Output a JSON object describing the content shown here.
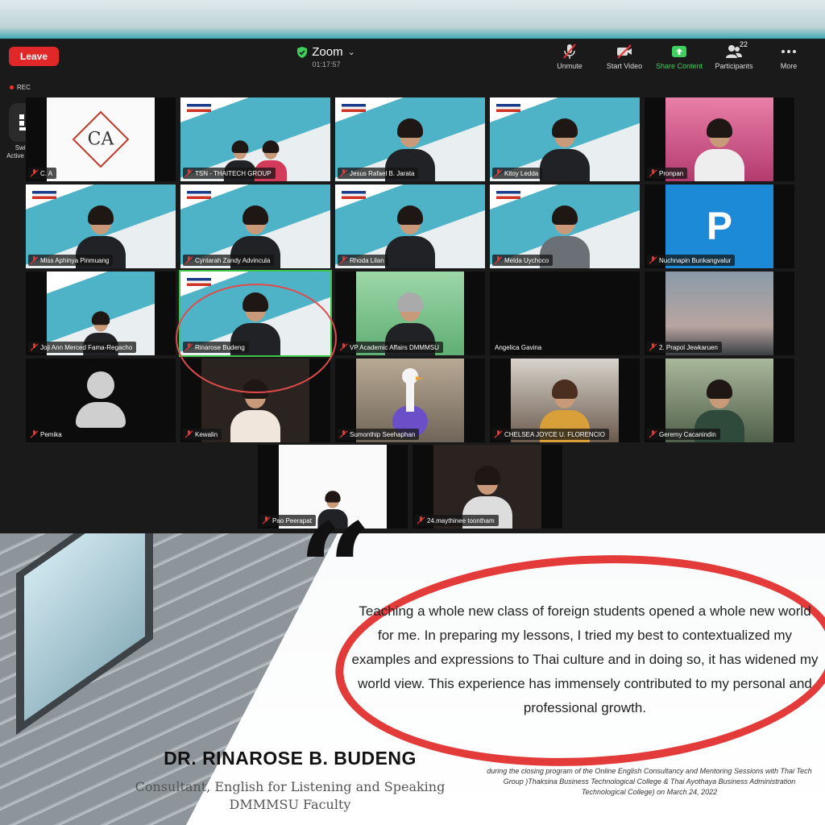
{
  "zoom": {
    "leave_label": "Leave",
    "title": "Zoom",
    "timer": "01:17:57",
    "rec_label": "REC",
    "switch_label_line1": "Switch to",
    "switch_label_line2": "Active Speaker",
    "participant_count": "22",
    "toolbar": [
      {
        "label": "Unmute",
        "icon": "mic-off-icon"
      },
      {
        "label": "Start Video",
        "icon": "video-off-icon"
      },
      {
        "label": "Share Content",
        "icon": "share-icon"
      },
      {
        "label": "Participants",
        "icon": "participants-icon"
      },
      {
        "label": "More",
        "icon": "more-icon"
      }
    ],
    "tiles": [
      {
        "name": "C. A"
      },
      {
        "name": "TSN - THAITECH GROUP"
      },
      {
        "name": "Jesus Rafael B. Jarata"
      },
      {
        "name": "Kitoy Ledda"
      },
      {
        "name": "Pronpan"
      },
      {
        "name": "Miss Aphinya Pinmuang"
      },
      {
        "name": "Cyntarah Zandy Advincula"
      },
      {
        "name": "Rhoda Lilan"
      },
      {
        "name": "Melda Uychoco"
      },
      {
        "name": "Nuchnapin Bunkangvalur",
        "avatar_letter": "P"
      },
      {
        "name": "Joji Ann Merced Fama-Regacho"
      },
      {
        "name": "Rinarose Budeng"
      },
      {
        "name": "VP Academic Affairs DMMMSU"
      },
      {
        "name": "Angelica Gavina"
      },
      {
        "name": "2. Prapol Jewkaruen"
      },
      {
        "name": "Pemika"
      },
      {
        "name": "Kewalin"
      },
      {
        "name": "Sumonthip Seehaphan"
      },
      {
        "name": "CHELSEA JOYCE U. FLORENCIO"
      },
      {
        "name": "Geremy Cacanindin"
      },
      {
        "name": "Pao Peerapat"
      },
      {
        "name": "24.maythinee toontham"
      }
    ],
    "logo_text": "CA"
  },
  "testimonial": {
    "quote": "Teaching a whole new class of foreign students opened a whole new world for me. In preparing my lessons, I tried my best to contextualized my examples and expressions to Thai culture and in doing so, it has widened my world view. This experience has immensely contributed to my personal and professional growth.",
    "name": "DR. RINAROSE B. BUDENG",
    "role_line1": "Consultant, English for Listening and Speaking",
    "role_line2": "DMMMSU Faculty",
    "caption": "during the closing program of the Online English Consultancy and Mentoring Sessions with Thai Tech Group )Thaksina Business Technological College & Thai Ayothaya Business Administration Technological College) on March 24, 2022"
  },
  "colors": {
    "leave_red": "#e02828",
    "share_green": "#3fcf5c",
    "active_tile_green": "#3ec24a",
    "highlight_red": "#e33a3a",
    "zoom_bg": "#1a1a1a"
  }
}
